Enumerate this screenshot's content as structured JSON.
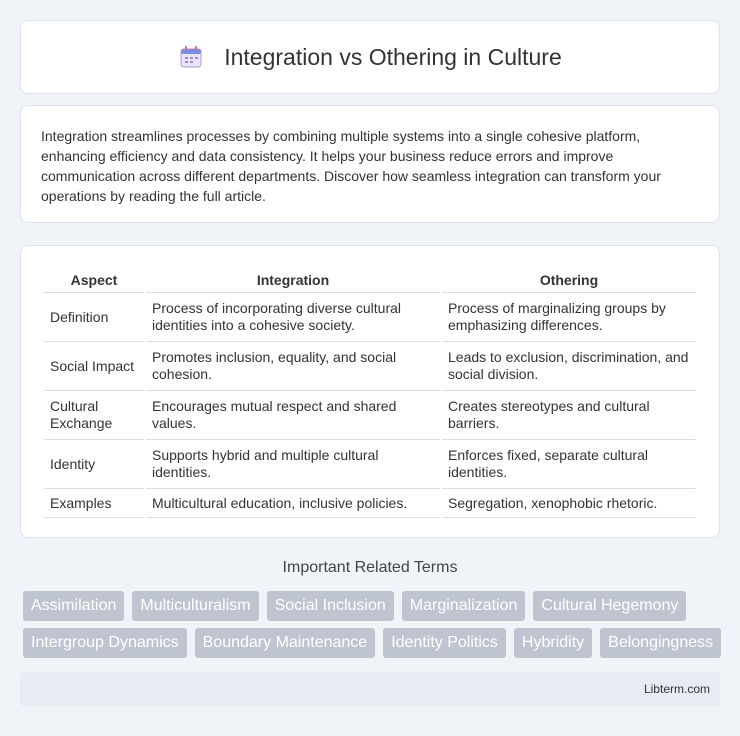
{
  "header": {
    "title": "Integration vs Othering in Culture",
    "icon": "calendar-icon"
  },
  "intro": {
    "text": "Integration streamlines processes by combining multiple systems into a single cohesive platform, enhancing efficiency and data consistency. It helps your business reduce errors and improve communication across different departments. Discover how seamless integration can transform your operations by reading the full article."
  },
  "table": {
    "headers": [
      "Aspect",
      "Integration",
      "Othering"
    ],
    "rows": [
      [
        "Definition",
        "Process of incorporating diverse cultural identities into a cohesive society.",
        "Process of marginalizing groups by emphasizing differences."
      ],
      [
        "Social Impact",
        "Promotes inclusion, equality, and social cohesion.",
        "Leads to exclusion, discrimination, and social division."
      ],
      [
        "Cultural Exchange",
        "Encourages mutual respect and shared values.",
        "Creates stereotypes and cultural barriers."
      ],
      [
        "Identity",
        "Supports hybrid and multiple cultural identities.",
        "Enforces fixed, separate cultural identities."
      ],
      [
        "Examples",
        "Multicultural education, inclusive policies.",
        "Segregation, xenophobic rhetoric."
      ]
    ]
  },
  "related": {
    "title": "Important Related Terms",
    "row1": [
      "Assimilation",
      "Multiculturalism",
      "Social Inclusion",
      "Marginalization",
      "Cultural Hegemony"
    ],
    "row2": [
      "Intergroup Dynamics",
      "Boundary Maintenance",
      "Identity Politics",
      "Hybridity",
      "Belongingness"
    ]
  },
  "footer": {
    "text": "Libterm.com"
  },
  "colors": {
    "tag_bg": "#bec5d1",
    "page_bg": "#f0f3f8",
    "footer_bg": "#e6ebf4"
  }
}
